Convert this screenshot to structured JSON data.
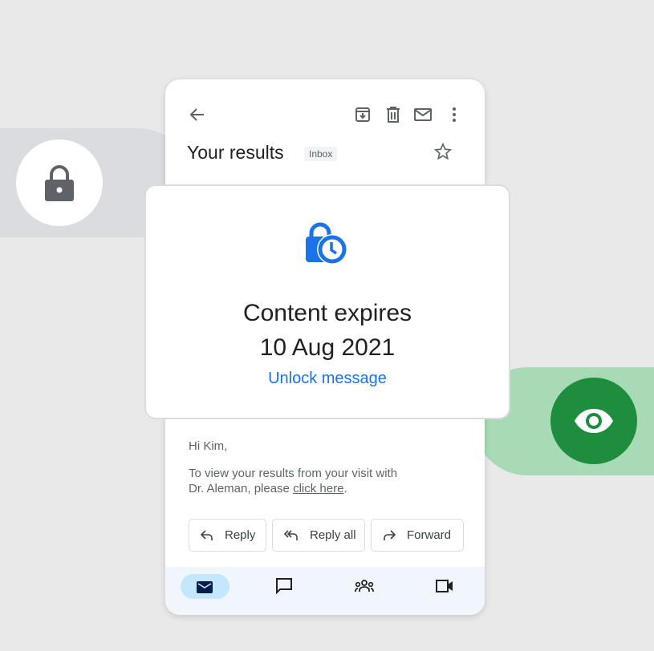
{
  "header": {
    "title": "Your results",
    "badge": "Inbox"
  },
  "email": {
    "greeting": "Hi Kim,",
    "body_prefix": "To view your results from your visit with Dr. Aleman, please ",
    "link": "click here",
    "body_suffix": "."
  },
  "actions": [
    {
      "label": "Reply"
    },
    {
      "label": "Reply all"
    },
    {
      "label": "Forward"
    }
  ],
  "popup": {
    "line1": "Content expires",
    "line2": "10 Aug 2021",
    "unlock": "Unlock message"
  },
  "colors": {
    "accent": "#1a73e8",
    "green": "#1e8e3e",
    "green_light": "#a8dab5",
    "nav_active": "#c2e7ff"
  }
}
